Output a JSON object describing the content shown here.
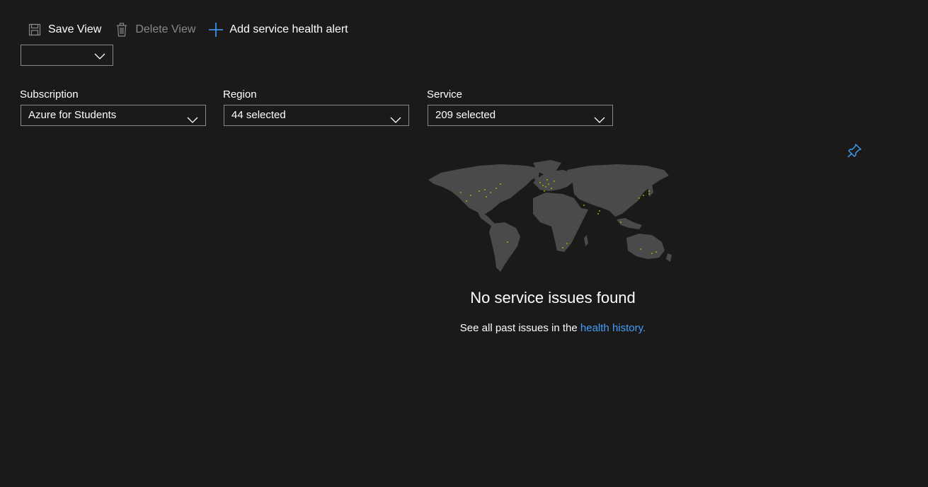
{
  "toolbar": {
    "save_label": "Save View",
    "delete_label": "Delete View",
    "add_alert_label": "Add service health alert"
  },
  "view_selector": {
    "value": ""
  },
  "filters": {
    "subscription": {
      "label": "Subscription",
      "value": "Azure for Students"
    },
    "region": {
      "label": "Region",
      "value": "44 selected"
    },
    "service": {
      "label": "Service",
      "value": "209 selected"
    }
  },
  "empty_state": {
    "title": "No service issues found",
    "subtitle_prefix": "See all past issues in the ",
    "link_text": "health history."
  },
  "colors": {
    "background": "#1b1a19",
    "accent": "#3f9fff",
    "map_land": "#4a4a4a",
    "region_dot": "#7fba00"
  }
}
